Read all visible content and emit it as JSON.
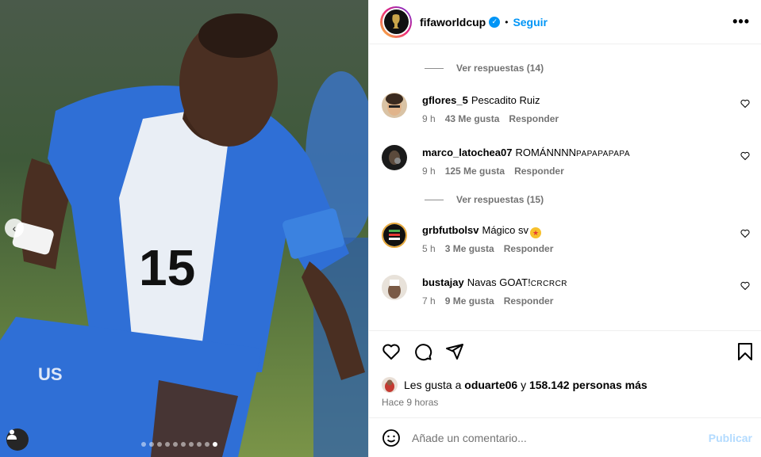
{
  "header": {
    "username": "fifaworldcup",
    "separator": "•",
    "follow_label": "Seguir",
    "more_label": "•••"
  },
  "comments": {
    "replies_1": "Ver respuestas (14)",
    "replies_2": "Ver respuestas (15)",
    "items": [
      {
        "user": "gflores_5",
        "text": "Pescadito Ruiz",
        "time": "9 h",
        "likes": "43 Me gusta",
        "reply": "Responder"
      },
      {
        "user": "marco_latochea07",
        "text": "ROMÁNNNN",
        "text_small": "PAPAPAPAPA",
        "time": "9 h",
        "likes": "125 Me gusta",
        "reply": "Responder"
      },
      {
        "user": "grbfutbolsv",
        "text": "Mágico sv",
        "time": "5 h",
        "likes": "3 Me gusta",
        "reply": "Responder"
      },
      {
        "user": "bustajay",
        "text": "Navas GOAT!",
        "text_small": "CRCRCR",
        "time": "7 h",
        "likes": "9 Me gusta",
        "reply": "Responder"
      }
    ]
  },
  "likes": {
    "prefix": "Les gusta a",
    "user": "oduarte06",
    "connector": "y",
    "others": "158.142 personas más"
  },
  "timestamp": "Hace 9 horas",
  "composer": {
    "placeholder": "Añade un comentario...",
    "publish_label": "Publicar"
  },
  "media": {
    "prev_arrow": "‹",
    "dots_count": 10,
    "active_dot": 9
  },
  "colors": {
    "accent": "#0095f6",
    "muted": "#737373",
    "publish_disabled": "#b3dbff",
    "jersey_blue": "#2f6fd6"
  }
}
